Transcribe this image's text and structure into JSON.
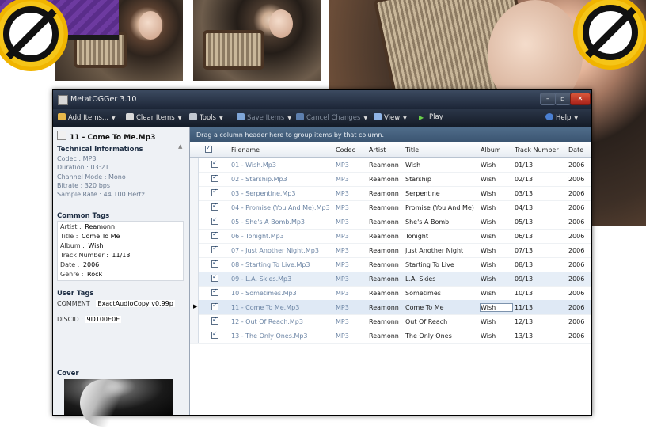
{
  "window": {
    "title": "MetatOGGer 3.10",
    "min_glyph": "–",
    "max_glyph": "▫",
    "close_glyph": "✕"
  },
  "toolbar": {
    "add_items": "Add Items...",
    "clear_items": "Clear Items",
    "tools": "Tools",
    "save_items": "Save Items",
    "cancel_changes": "Cancel Changes",
    "view": "View",
    "play": "Play",
    "help": "Help"
  },
  "details": {
    "file_title": "11 - Come To Me.Mp3",
    "technical": {
      "title": "Technical Informations",
      "codec": "Codec : MP3",
      "duration": "Duration : 03:21",
      "channel_mode": "Channel Mode : Mono",
      "bitrate": "Bitrate : 320 bps",
      "sample_rate": "Sample Rate : 44 100 Hertz"
    },
    "common": {
      "title": "Common Tags",
      "artist_label": "Artist :",
      "artist": "Reamonn",
      "title_label": "Title :",
      "title_value": "Come To Me",
      "album_label": "Album :",
      "album": "Wish",
      "track_label": "Track Number :",
      "track": "11/13",
      "date_label": "Date :",
      "date": "2006",
      "genre_label": "Genre :",
      "genre": "Rock"
    },
    "user": {
      "title": "User Tags",
      "comment_label": "COMMENT :",
      "comment": "ExactAudioCopy v0.99p",
      "discid_label": "DISCID :",
      "discid": "9D100E0E"
    },
    "cover_title": "Cover"
  },
  "grid": {
    "group_hint": "Drag a column header here to group items by that column.",
    "columns": [
      "Filename",
      "Codec",
      "Artist",
      "Title",
      "Album",
      "Track Number",
      "Date"
    ],
    "rows": [
      {
        "filename": "01 - Wish.Mp3",
        "codec": "MP3",
        "artist": "Reamonn",
        "title": "Wish",
        "album": "Wish",
        "track": "01/13",
        "date": "2006"
      },
      {
        "filename": "02 - Starship.Mp3",
        "codec": "MP3",
        "artist": "Reamonn",
        "title": "Starship",
        "album": "Wish",
        "track": "02/13",
        "date": "2006"
      },
      {
        "filename": "03 - Serpentine.Mp3",
        "codec": "MP3",
        "artist": "Reamonn",
        "title": "Serpentine",
        "album": "Wish",
        "track": "03/13",
        "date": "2006"
      },
      {
        "filename": "04 - Promise (You And Me).Mp3",
        "codec": "MP3",
        "artist": "Reamonn",
        "title": "Promise (You And Me)",
        "album": "Wish",
        "track": "04/13",
        "date": "2006"
      },
      {
        "filename": "05 - She's A Bomb.Mp3",
        "codec": "MP3",
        "artist": "Reamonn",
        "title": "She's A Bomb",
        "album": "Wish",
        "track": "05/13",
        "date": "2006"
      },
      {
        "filename": "06 - Tonight.Mp3",
        "codec": "MP3",
        "artist": "Reamonn",
        "title": "Tonight",
        "album": "Wish",
        "track": "06/13",
        "date": "2006"
      },
      {
        "filename": "07 - Just Another Night.Mp3",
        "codec": "MP3",
        "artist": "Reamonn",
        "title": "Just Another Night",
        "album": "Wish",
        "track": "07/13",
        "date": "2006"
      },
      {
        "filename": "08 - Starting To Live.Mp3",
        "codec": "MP3",
        "artist": "Reamonn",
        "title": "Starting To Live",
        "album": "Wish",
        "track": "08/13",
        "date": "2006"
      },
      {
        "filename": "09 - L.A. Skies.Mp3",
        "codec": "MP3",
        "artist": "Reamonn",
        "title": "L.A. Skies",
        "album": "Wish",
        "track": "09/13",
        "date": "2006"
      },
      {
        "filename": "10 - Sometimes.Mp3",
        "codec": "MP3",
        "artist": "Reamonn",
        "title": "Sometimes",
        "album": "Wish",
        "track": "10/13",
        "date": "2006"
      },
      {
        "filename": "11 - Come To Me.Mp3",
        "codec": "MP3",
        "artist": "Reamonn",
        "title": "Come To Me",
        "album": "Wish",
        "track": "11/13",
        "date": "2006"
      },
      {
        "filename": "12 - Out Of Reach.Mp3",
        "codec": "MP3",
        "artist": "Reamonn",
        "title": "Out Of Reach",
        "album": "Wish",
        "track": "12/13",
        "date": "2006"
      },
      {
        "filename": "13 - The Only Ones.Mp3",
        "codec": "MP3",
        "artist": "Reamonn",
        "title": "The Only Ones",
        "album": "Wish",
        "track": "13/13",
        "date": "2006"
      }
    ],
    "current_row": 10,
    "selected_row": 8
  },
  "colors": {
    "badge_yellow": "#f5c518",
    "banner_purple": "#5a2d8a",
    "toolbar_dark": "#1c2536",
    "filename_blue": "#6b84a4"
  }
}
